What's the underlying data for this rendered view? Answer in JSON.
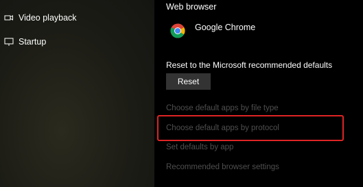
{
  "nav": {
    "items": [
      {
        "label": "Video playback",
        "icon": "video-playback-icon"
      },
      {
        "label": "Startup",
        "icon": "startup-icon"
      }
    ]
  },
  "web_browser": {
    "heading": "Web browser",
    "default_app": "Google Chrome",
    "icon": "chrome-icon"
  },
  "reset": {
    "heading": "Reset to the Microsoft recommended defaults",
    "button_label": "Reset"
  },
  "links": {
    "by_file_type": "Choose default apps by file type",
    "by_protocol": "Choose default apps by protocol",
    "by_app": "Set defaults by app",
    "browser_settings": "Recommended browser settings"
  },
  "colors": {
    "link_text": "#4f4f4f",
    "highlight_border": "#e02424",
    "button_bg": "#333333"
  }
}
